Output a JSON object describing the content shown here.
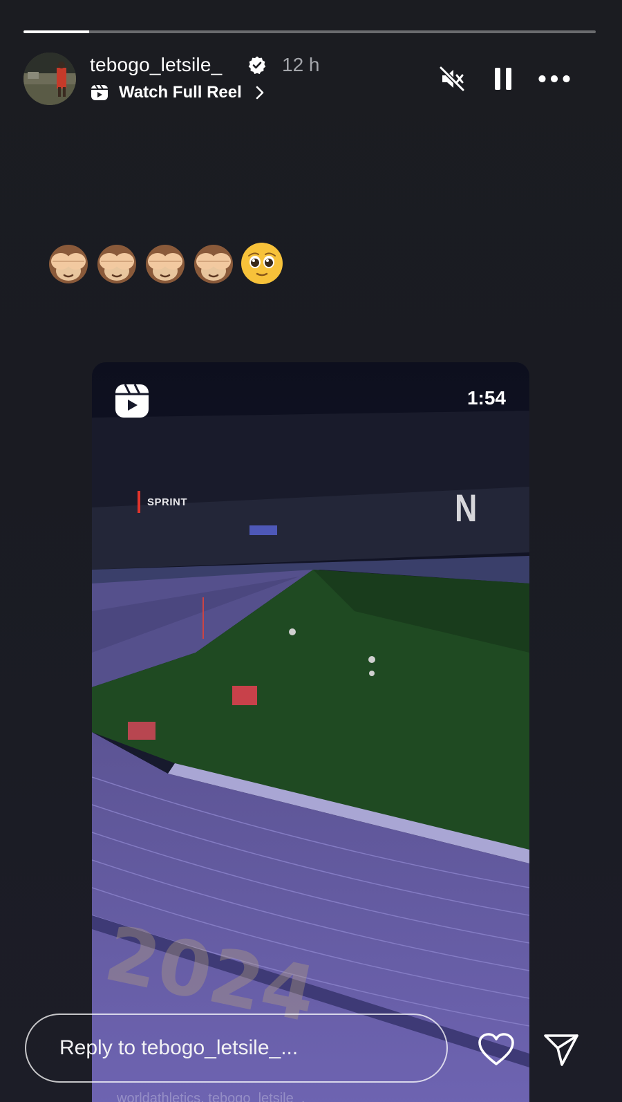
{
  "progress": {
    "fraction": 0.115
  },
  "header": {
    "username": "tebogo_letsile_",
    "time": "12 h",
    "reel_link_label": "Watch Full Reel"
  },
  "icons": {
    "avatar": "profile-photo",
    "verified": "verified-badge-icon",
    "reel": "reels-icon",
    "chevron": "chevron-right-icon",
    "muted": "speaker-muted-icon",
    "pause": "pause-icon",
    "more": "more-options-icon",
    "heart": "heart-icon",
    "send": "send-icon"
  },
  "emojis": [
    "🙈",
    "🙈",
    "🙈",
    "🙈",
    "🥹"
  ],
  "reel": {
    "duration": "1:54",
    "overlay_tag": "SPRINT",
    "channel_logo": "N",
    "tagged_accounts": "worldathletics, tebogo_letsile_,"
  },
  "footer": {
    "reply_placeholder": "Reply to tebogo_letsile_..."
  },
  "colors": {
    "background": "#1b1c21",
    "track": "#6b62b4",
    "field": "#1f4a22",
    "accent": "#e0342c"
  }
}
